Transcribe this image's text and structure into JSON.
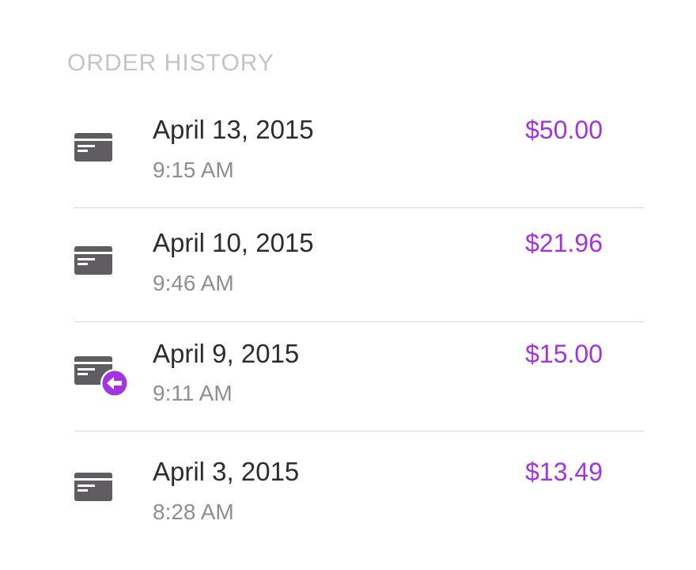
{
  "section": {
    "title": "ORDER HISTORY"
  },
  "colors": {
    "accent": "#a433e0",
    "primary_text": "#2d2d31",
    "secondary_text": "#8e8e93",
    "header_text": "#c4c4c7",
    "icon": "#5f5c62",
    "divider": "#d9d9dc"
  },
  "orders": [
    {
      "date": "April 13, 2015",
      "time": "9:15 AM",
      "amount": "$50.00",
      "icon": "credit-card-icon"
    },
    {
      "date": "April 10, 2015",
      "time": "9:46 AM",
      "amount": "$21.96",
      "icon": "credit-card-icon"
    },
    {
      "date": "April 9, 2015",
      "time": "9:11 AM",
      "amount": "$15.00",
      "icon": "credit-card-refund-icon"
    },
    {
      "date": "April 3, 2015",
      "time": "8:28 AM",
      "amount": "$13.49",
      "icon": "credit-card-icon"
    }
  ]
}
